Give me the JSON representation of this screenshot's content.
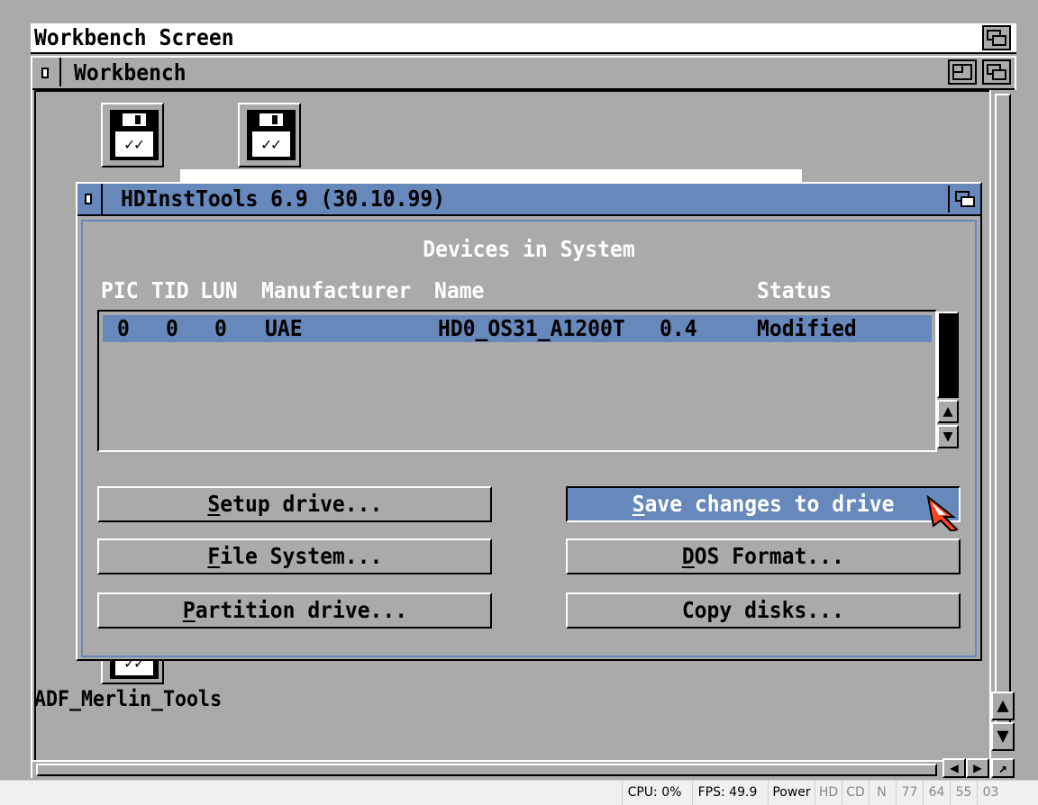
{
  "screen": {
    "title": "Workbench Screen"
  },
  "workbench": {
    "title": "Workbench",
    "icons": [
      {
        "label": "ADF_Merlin_Tools"
      }
    ]
  },
  "dialog": {
    "title": "HDInstTools 6.9 (30.10.99)",
    "heading": "Devices in System",
    "columns": [
      "PIC",
      "TID",
      "LUN",
      "Manufacturer",
      "Name",
      "Status"
    ],
    "devices": [
      {
        "pic": "0",
        "tid": "0",
        "lun": "0",
        "manufacturer": "UAE",
        "name": "HD0_OS31_A1200T",
        "revision": "0.4",
        "status": "Modified"
      }
    ],
    "buttons": {
      "setup": {
        "key": "S",
        "rest": "etup drive..."
      },
      "filesystem": {
        "key": "F",
        "rest": "ile System..."
      },
      "partition": {
        "key": "P",
        "rest": "artition drive..."
      },
      "save": {
        "key": "S",
        "rest": "ave changes to drive"
      },
      "dosformat": {
        "key": "D",
        "rest": "OS Format..."
      },
      "copy": {
        "pre": "Copy disks..."
      }
    }
  },
  "hostbar": {
    "cpu": "CPU: 0%",
    "fps": "FPS: 49.9",
    "power": "Power",
    "hd": "HD",
    "cd": "CD",
    "n": "N",
    "t1": "77",
    "t2": "64",
    "t3": "55",
    "t4": "03"
  },
  "colors": {
    "desktop": "#aaaaaa",
    "highlight": "#6688bb",
    "pointer": "#ff4422"
  },
  "icons": [
    "depth-gadget-icon",
    "zoom-gadget-icon",
    "close-gadget-icon",
    "floppy-disk-icon",
    "arrow-up-icon",
    "arrow-down-icon",
    "arrow-left-icon",
    "arrow-right-icon",
    "resize-icon",
    "mouse-pointer-icon"
  ]
}
